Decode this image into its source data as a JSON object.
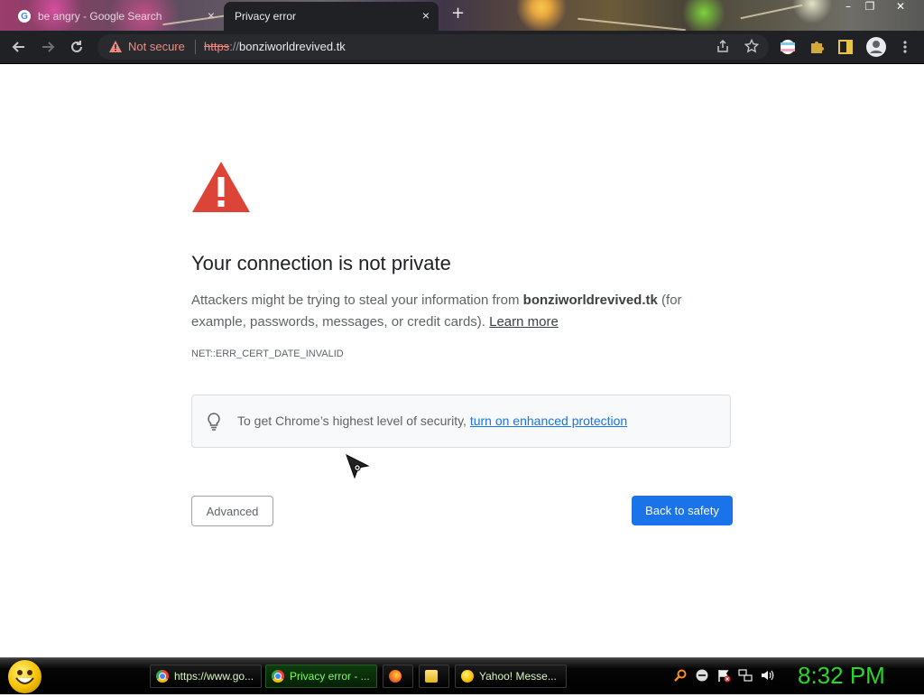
{
  "browser": {
    "tabs": [
      {
        "label": "be angry - Google Search",
        "close": "×",
        "active": false
      },
      {
        "label": "Privacy error",
        "close": "×",
        "active": true
      }
    ],
    "new_tab": "+",
    "window_controls": {
      "minimize": "–",
      "maximize": "❐",
      "close": "✕"
    },
    "toolbar": {
      "not_secure_label": "Not secure",
      "url_scheme": "https",
      "url_slashes": "://",
      "url_host": "bonziworldrevived.tk"
    }
  },
  "page": {
    "heading": "Your connection is not private",
    "description_pre": "Attackers might be trying to steal your information from ",
    "description_host": "bonziworldrevived.tk",
    "description_post": " (for example, passwords, messages, or credit cards). ",
    "learn_more": "Learn more",
    "error_code": "NET::ERR_CERT_DATE_INVALID",
    "tip_text": "To get Chrome’s highest level of security, ",
    "tip_link": "turn on enhanced protection",
    "advanced_button": "Advanced",
    "back_button": "Back to safety"
  },
  "taskbar": {
    "items": [
      {
        "label": "https://www.go...",
        "icon": "chrome-icon",
        "active": false
      },
      {
        "label": "Privacy error - ...",
        "icon": "chrome-icon",
        "active": true
      },
      {
        "label": "",
        "icon": "firefox-icon",
        "active": false
      },
      {
        "label": "",
        "icon": "folder-icon",
        "active": false
      },
      {
        "label": "Yahoo! Messe...",
        "icon": "yahoo-messenger-icon",
        "active": false
      }
    ],
    "clock": "8:32 PM"
  },
  "colors": {
    "accent_blue": "#1a73e8",
    "warning_red": "#db4437",
    "not_secure_red": "#f28b82",
    "clock_green": "#29d629"
  }
}
